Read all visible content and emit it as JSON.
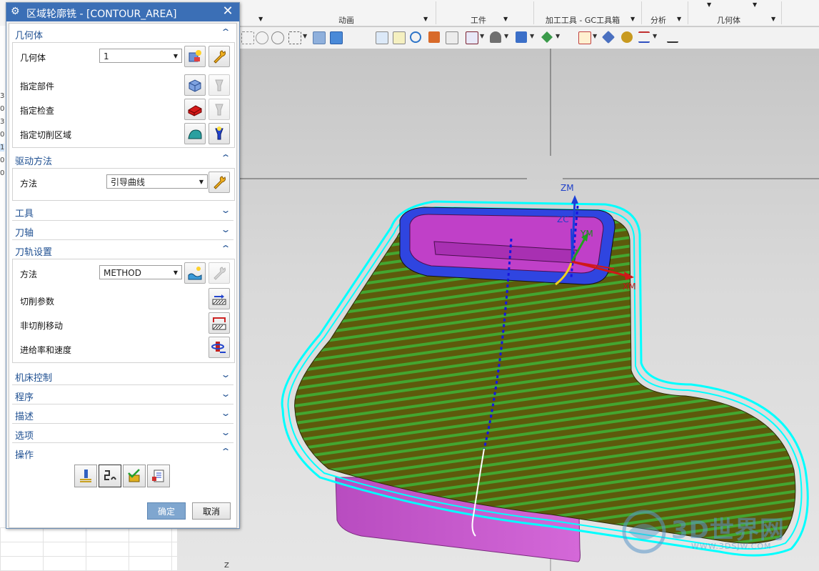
{
  "ribbon": {
    "groups": [
      "动画",
      "工件",
      "加工工具 - GC工具箱",
      "分析",
      "几何体"
    ]
  },
  "tree": {
    "numbers": [
      "3",
      "0",
      "3",
      "0",
      "1",
      "0",
      "0"
    ]
  },
  "dialog": {
    "title": "区域轮廓铣 - [CONTOUR_AREA]",
    "close_glyph": "✕",
    "sections": {
      "geometry": "几何体",
      "drive": "驱动方法",
      "tool": "工具",
      "axis": "刀轴",
      "path_settings": "刀轨设置",
      "machine_control": "机床控制",
      "program": "程序",
      "description": "描述",
      "options": "选项",
      "actions": "操作"
    },
    "geometry": {
      "geometry_label": "几何体",
      "geometry_value": "1",
      "part_label": "指定部件",
      "check_label": "指定检查",
      "cut_area_label": "指定切削区域"
    },
    "drive": {
      "method_label": "方法",
      "method_value": "引导曲线"
    },
    "path_settings": {
      "method_label": "方法",
      "method_value": "METHOD",
      "cut_params": "切削参数",
      "non_cut_moves": "非切削移动",
      "feeds_speeds": "进给率和速度"
    },
    "ok": "确定",
    "cancel": "取消"
  },
  "viewport": {
    "labels": {
      "zm": "ZM",
      "zc": "ZC",
      "ym": "YM",
      "xm": "XM",
      "z_bottom": "Z"
    },
    "colors": {
      "toolpath": "#00ffff",
      "part_top": "#3344ee",
      "pocket": "#c040c8",
      "stripe_dark": "#6b6a0e",
      "stripe_light": "#3fae2e"
    }
  },
  "watermark": {
    "text": "3D世界网",
    "sub": "WWW.3DSJW.COM"
  }
}
